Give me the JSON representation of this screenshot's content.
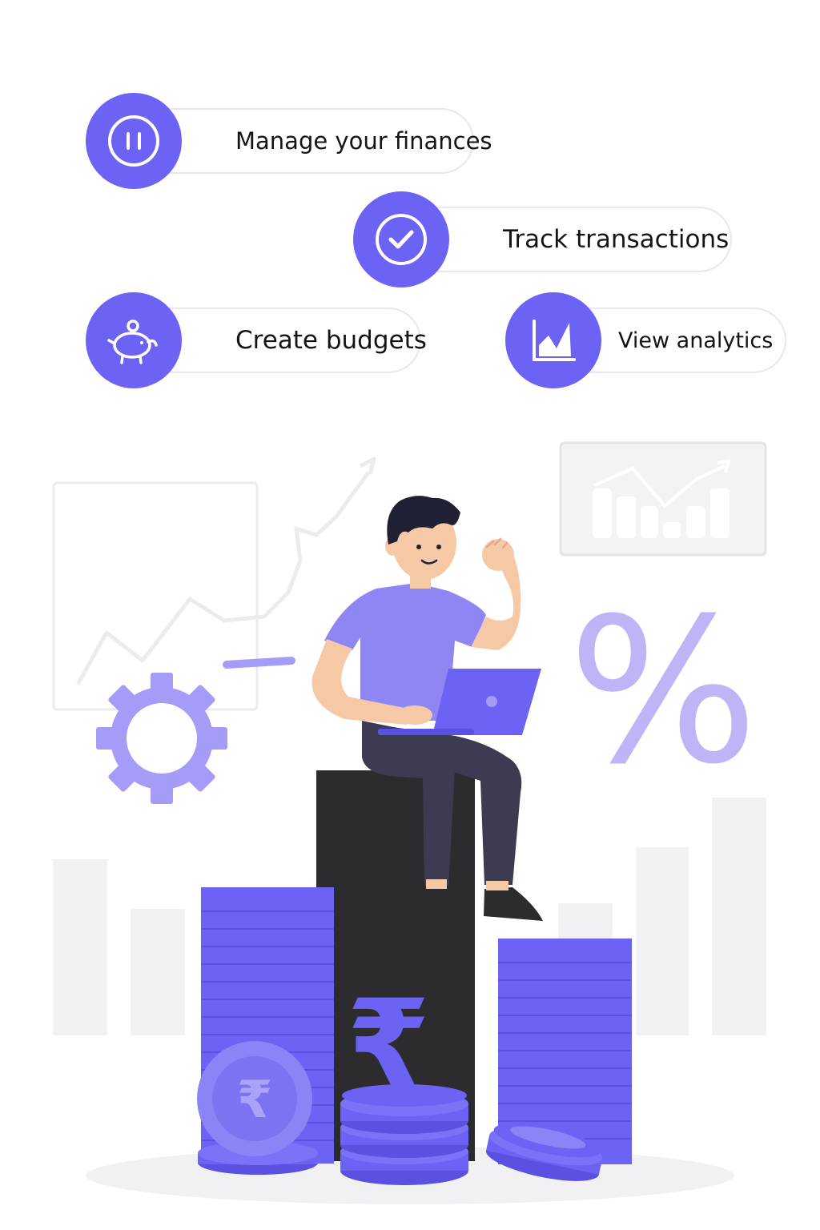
{
  "colors": {
    "accent": "#6c63f5",
    "accent_light": "#a49cf7",
    "dark": "#2c2c2e",
    "pill_border": "#e7e7ee",
    "background": "#ffffff"
  },
  "features": [
    {
      "label": "Manage your finances",
      "icon": "finance-pause-icon"
    },
    {
      "label": "Track transactions",
      "icon": "check-circle-icon"
    },
    {
      "label": "Create budgets",
      "icon": "piggy-bank-icon"
    },
    {
      "label": "View analytics",
      "icon": "analytics-chart-icon"
    }
  ],
  "illustration": {
    "currency_symbol": "₹",
    "percent_symbol": "%"
  }
}
